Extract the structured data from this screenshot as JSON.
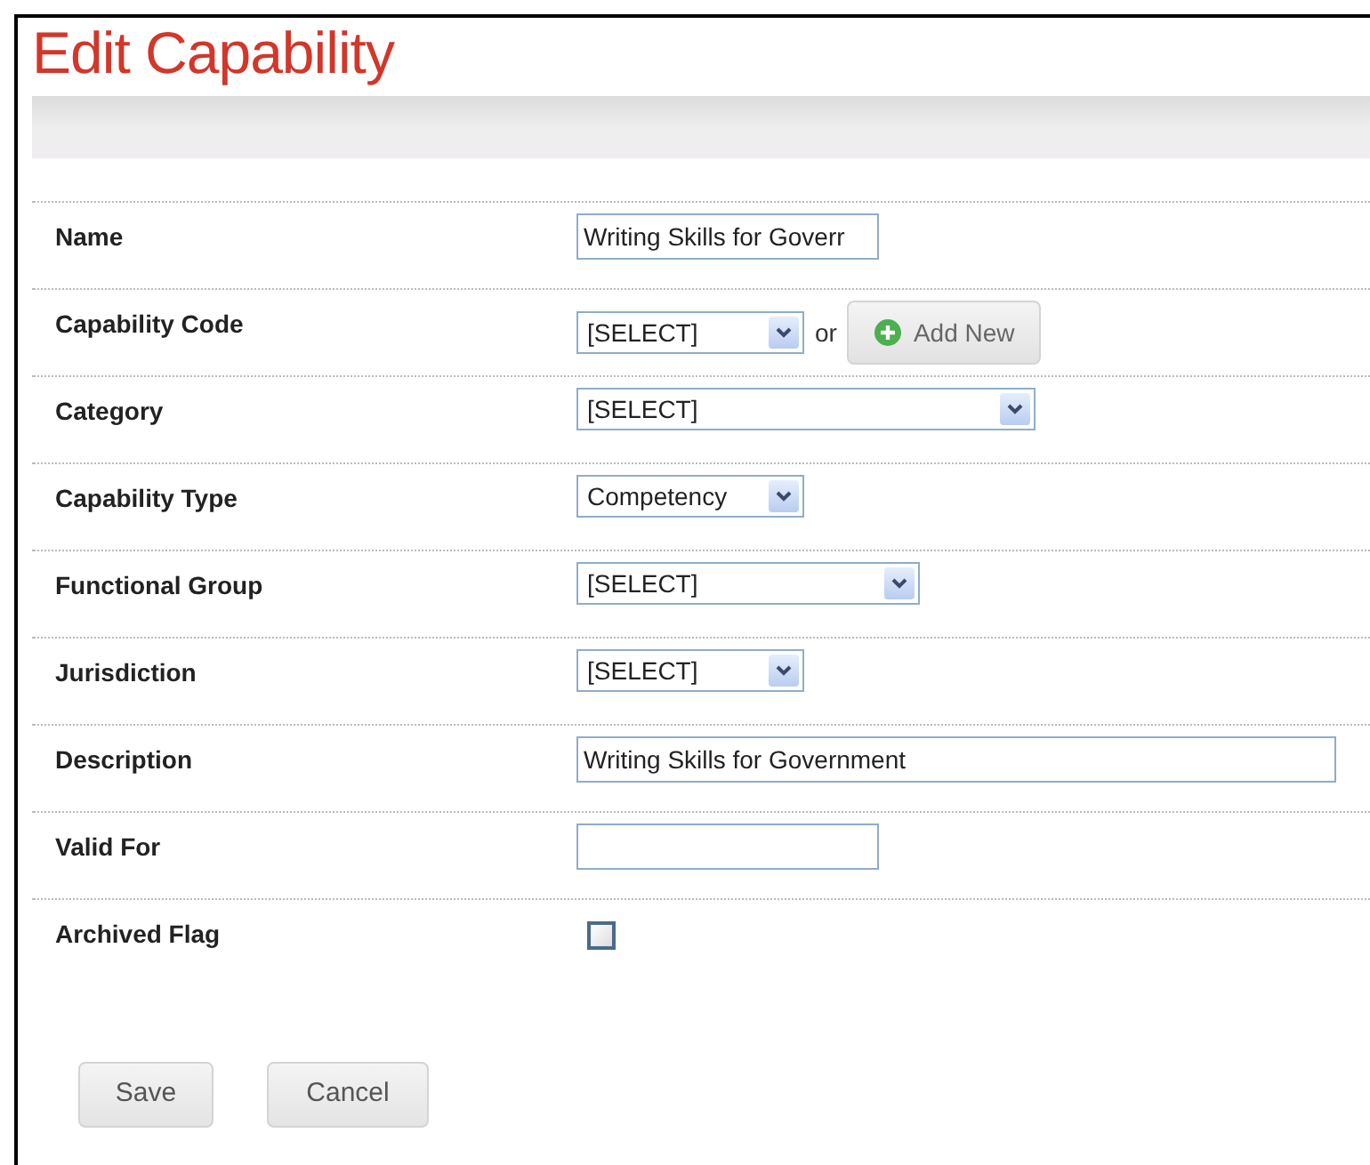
{
  "title": "Edit Capability",
  "fields": [
    {
      "label": "Name",
      "kind": "text",
      "value": "Writing Skills for Goverr"
    },
    {
      "label": "Capability Code",
      "kind": "select_add",
      "value": "[SELECT]",
      "joiner": "or",
      "add_button": "Add New"
    },
    {
      "label": "Category",
      "kind": "select",
      "value": "[SELECT]"
    },
    {
      "label": "Capability Type",
      "kind": "select",
      "value": "Competency"
    },
    {
      "label": "Functional Group",
      "kind": "select",
      "value": "[SELECT]"
    },
    {
      "label": "Jurisdiction",
      "kind": "select",
      "value": "[SELECT]"
    },
    {
      "label": "Description",
      "kind": "text",
      "value": "Writing Skills for Government"
    },
    {
      "label": "Valid For",
      "kind": "text"
    },
    {
      "label": "Archived Flag",
      "kind": "checkbox",
      "checked": false
    }
  ],
  "buttons": [
    "Save",
    "Cancel"
  ]
}
